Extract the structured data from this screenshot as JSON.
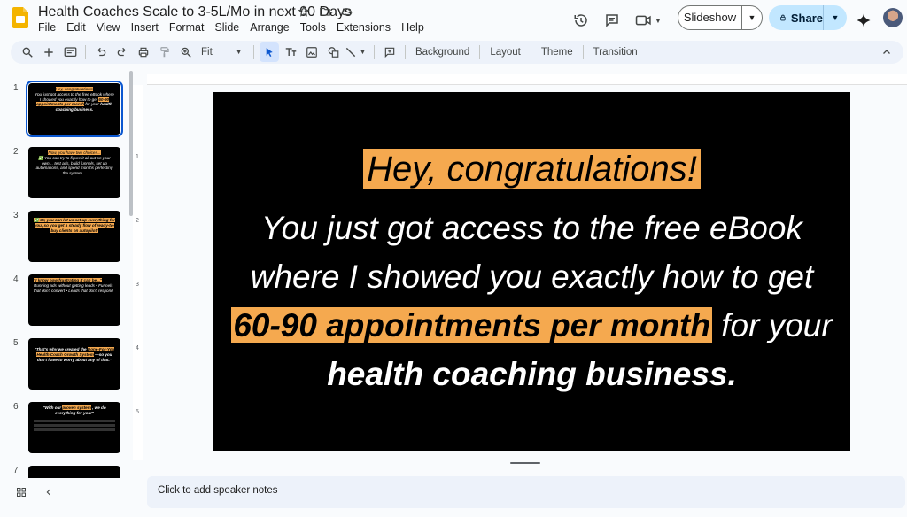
{
  "app": {
    "doc_title": "Health Coaches Scale to 3-5L/Mo in next 90 Days",
    "menu": [
      "File",
      "Edit",
      "View",
      "Insert",
      "Format",
      "Slide",
      "Arrange",
      "Tools",
      "Extensions",
      "Help"
    ],
    "slideshow_label": "Slideshow",
    "share_label": "Share",
    "accent_color": "#0b57d0",
    "share_bg": "#c2e7ff"
  },
  "toolbar": {
    "zoom_label": "Fit",
    "background_label": "Background",
    "layout_label": "Layout",
    "theme_label": "Theme",
    "transition_label": "Transition"
  },
  "filmstrip": {
    "numbers": [
      "1",
      "2",
      "3",
      "4",
      "5",
      "6",
      "7"
    ],
    "slides": [
      {
        "hl": "Hey, congratulations!",
        "text": "You just got access to the free eBook where I showed you exactly how to get",
        "bold_hl": "60-90 appointments per month",
        "tail": "for your",
        "bold": "health coaching business."
      },
      {
        "hl": "Now, you have two choices...",
        "text": "✅ You can try to figure it all out on your own… test ads, build funnels, set up automations, and spend months perfecting the system…"
      },
      {
        "hl": "✅ Or, you can let us set up everything for you, so you get a steady flow of ready-to-buy clients on autopilot!"
      },
      {
        "hl": "\"I know how frustrating it can be...\"",
        "text": "Running ads without getting leads • Funnels that don't convert • Leads that don't respond"
      },
      {
        "text": "\"That's why we created the",
        "hl": "Done-For-You Health Coach Growth System",
        "tail": "—so you don't have to worry about any of that.\""
      },
      {
        "text": "\"With our",
        "hl": "proven system",
        "tail": ", we do everything for you!\""
      }
    ],
    "accent_highlight": "#f5a94f"
  },
  "slide": {
    "headline": "Hey, congratulations!",
    "line_a": "You just got access to the free eBook where I showed you exactly how to get ",
    "highlight": "60-90 appointments per month",
    "line_b": " for your ",
    "bold_tail": "health coaching business.",
    "highlight_color": "#f5a94f"
  },
  "ruler": {
    "top": [
      "1",
      "2",
      "3",
      "4",
      "5",
      "6",
      "7",
      "8",
      "9"
    ],
    "left": [
      "1",
      "2",
      "3",
      "4",
      "5"
    ]
  },
  "notes": {
    "placeholder": "Click to add speaker notes"
  }
}
